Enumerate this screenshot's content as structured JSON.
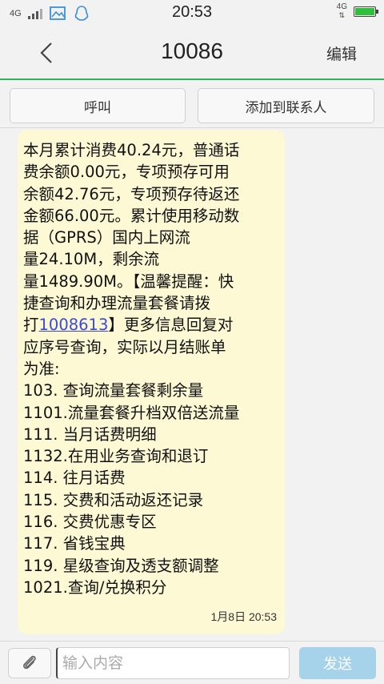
{
  "status_bar": {
    "network_left": "4G",
    "time": "20:53",
    "network_right": "4G",
    "colors": {
      "battery": "#2fbf3a"
    }
  },
  "header": {
    "title": "10086",
    "edit_label": "编辑",
    "accent_color": "#2fb55a"
  },
  "actions": {
    "call_label": "呼叫",
    "add_contact_label": "添加到联系人"
  },
  "message": {
    "text_before_link": "本月累计消费40.24元，普通话\n费余额0.00元，专项预存可用\n余额42.76元，专项预存待返还\n金额66.00元。累计使用移动数\n据（GPRS）国内上网流\n量24.10M，剩余流\n量1489.90M。【温馨提醒：快\n捷查询和办理流量套餐请拨\n打",
    "link": "1008613",
    "text_after_link": "】更多信息回复对\n应序号查询，实际以月结账单\n为准:\n103. 查询流量套餐剩余量\n1101.流量套餐升档双倍送流量\n111. 当月话费明细\n1132.在用业务查询和退订\n114. 往月话费\n115. 交费和活动返还记录\n116. 交费优惠专区\n117. 省钱宝典\n119. 星级查询及透支额调整\n1021.查询/兑换积分",
    "timestamp": "1月8日 20:53",
    "bubble_color": "#fdf9d4",
    "link_color": "#3b49d8"
  },
  "input_bar": {
    "placeholder": "输入内容",
    "value": "",
    "send_label": "发送",
    "send_color": "#a7d3ea"
  }
}
